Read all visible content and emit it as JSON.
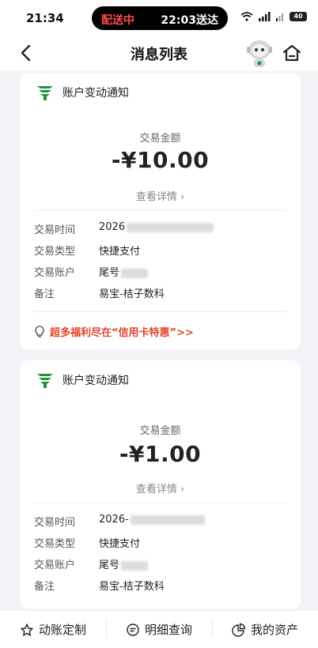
{
  "status_bar": {
    "time": "21:34",
    "delivery_status": "配送中",
    "delivery_eta": "22:03送达",
    "battery": "40"
  },
  "nav": {
    "title": "消息列表"
  },
  "cards": [
    {
      "header_title": "账户变动通知",
      "amount_label": "交易金额",
      "amount": "-¥10.00",
      "details_link": "查看详情 ›",
      "rows": [
        {
          "label": "交易时间",
          "value": "2026"
        },
        {
          "label": "交易类型",
          "value": "快捷支付"
        },
        {
          "label": "交易账户",
          "value": "尾号"
        },
        {
          "label": "备注",
          "value": "易宝-桔子数科"
        }
      ],
      "promo": "超多福利尽在“信用卡特惠”>>"
    },
    {
      "header_title": "账户变动通知",
      "amount_label": "交易金额",
      "amount": "-¥1.00",
      "details_link": "查看详情 ›",
      "rows": [
        {
          "label": "交易时间",
          "value": "2026-"
        },
        {
          "label": "交易类型",
          "value": "快捷支付"
        },
        {
          "label": "交易账户",
          "value": "尾号"
        },
        {
          "label": "备注",
          "value": "易宝-桔子数科"
        }
      ]
    }
  ],
  "bottom_tabs": [
    {
      "label": "动账定制",
      "icon": "star-settings-icon"
    },
    {
      "label": "明细查询",
      "icon": "search-list-icon"
    },
    {
      "label": "我的资产",
      "icon": "pie-chart-icon"
    }
  ],
  "colors": {
    "promo": "#e0462f",
    "brand_green": "#1f8f3a",
    "background": "#f4f2f7"
  }
}
